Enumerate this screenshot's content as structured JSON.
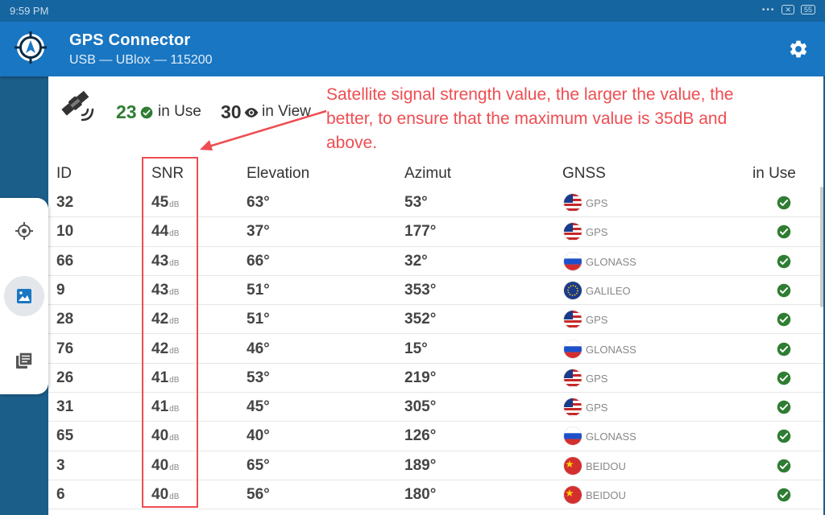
{
  "status_bar": {
    "time": "9:59 PM",
    "battery": "55"
  },
  "app_bar": {
    "title": "GPS Connector",
    "subtitle": "USB — UBlox — 115200"
  },
  "summary": {
    "in_use_count": "23",
    "in_use_label": "in Use",
    "in_view_count": "30",
    "in_view_label": "in View"
  },
  "annotation": {
    "text": "Satellite signal strength value, the larger the value, the better, to ensure that the maximum value is 35dB and above."
  },
  "table": {
    "headers": {
      "id": "ID",
      "snr": "SNR",
      "elevation": "Elevation",
      "azimut": "Azimut",
      "gnss": "GNSS",
      "in_use": "in Use"
    },
    "unit": "dB",
    "rows": [
      {
        "id": "32",
        "snr": "45",
        "elevation": "63°",
        "azimut": "53°",
        "gnss": "GPS",
        "flag": "us"
      },
      {
        "id": "10",
        "snr": "44",
        "elevation": "37°",
        "azimut": "177°",
        "gnss": "GPS",
        "flag": "us"
      },
      {
        "id": "66",
        "snr": "43",
        "elevation": "66°",
        "azimut": "32°",
        "gnss": "GLONASS",
        "flag": "ru"
      },
      {
        "id": "9",
        "snr": "43",
        "elevation": "51°",
        "azimut": "353°",
        "gnss": "GALILEO",
        "flag": "eu"
      },
      {
        "id": "28",
        "snr": "42",
        "elevation": "51°",
        "azimut": "352°",
        "gnss": "GPS",
        "flag": "us"
      },
      {
        "id": "76",
        "snr": "42",
        "elevation": "46°",
        "azimut": "15°",
        "gnss": "GLONASS",
        "flag": "ru"
      },
      {
        "id": "26",
        "snr": "41",
        "elevation": "53°",
        "azimut": "219°",
        "gnss": "GPS",
        "flag": "us"
      },
      {
        "id": "31",
        "snr": "41",
        "elevation": "45°",
        "azimut": "305°",
        "gnss": "GPS",
        "flag": "us"
      },
      {
        "id": "65",
        "snr": "40",
        "elevation": "40°",
        "azimut": "126°",
        "gnss": "GLONASS",
        "flag": "ru"
      },
      {
        "id": "3",
        "snr": "40",
        "elevation": "65°",
        "azimut": "189°",
        "gnss": "BEIDOU",
        "flag": "cn"
      },
      {
        "id": "6",
        "snr": "40",
        "elevation": "56°",
        "azimut": "180°",
        "gnss": "BEIDOU",
        "flag": "cn"
      }
    ]
  },
  "colors": {
    "app_bar": "#1976c2",
    "status_bar": "#1565a0",
    "annotation": "#ee4d51",
    "check": "#2f7d32"
  },
  "nav": {
    "items": [
      "gps-target-icon",
      "image-icon",
      "log-icon"
    ],
    "active_index": 1
  }
}
